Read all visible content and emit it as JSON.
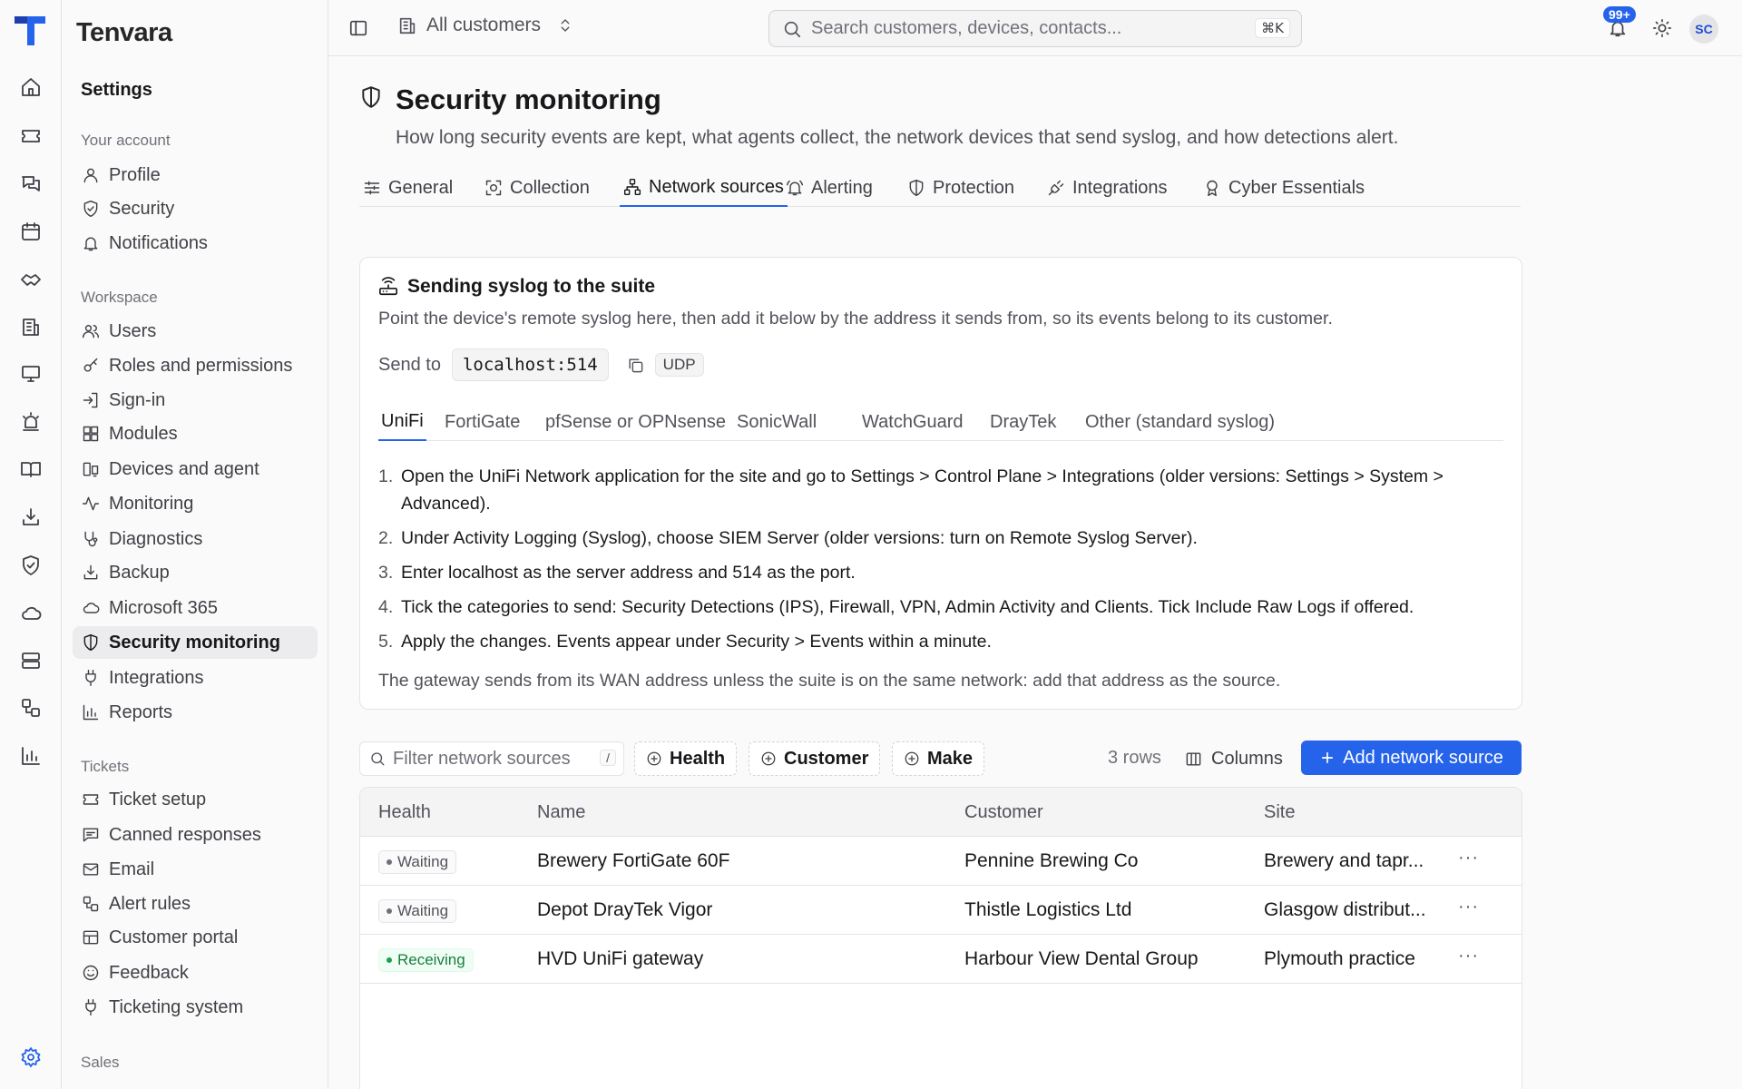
{
  "app": {
    "brand": "Tenvara"
  },
  "sidebar": {
    "title": "Settings",
    "groups": [
      {
        "label": "Your account",
        "items": [
          "Profile",
          "Security",
          "Notifications"
        ]
      },
      {
        "label": "Workspace",
        "items": [
          "Users",
          "Roles and permissions",
          "Sign-in",
          "Modules",
          "Devices and agent",
          "Monitoring",
          "Diagnostics",
          "Backup",
          "Microsoft 365",
          "Security monitoring",
          "Integrations",
          "Reports"
        ]
      },
      {
        "label": "Tickets",
        "items": [
          "Ticket setup",
          "Canned responses",
          "Email",
          "Alert rules",
          "Customer portal",
          "Feedback",
          "Ticketing system"
        ]
      },
      {
        "label": "Sales",
        "items": []
      }
    ],
    "active": "Security monitoring"
  },
  "topbar": {
    "customer_scope": "All customers",
    "search_placeholder": "Search customers, devices, contacts...",
    "search_shortcut": "⌘K",
    "notifications_badge": "99+",
    "avatar_initials": "SC"
  },
  "page": {
    "title": "Security monitoring",
    "subtitle": "How long security events are kept, what agents collect, the network devices that send syslog, and how detections alert.",
    "tabs": [
      "General",
      "Collection",
      "Network sources",
      "Alerting",
      "Protection",
      "Integrations",
      "Cyber Essentials"
    ],
    "active_tab": "Network sources"
  },
  "syslog_card": {
    "title": "Sending syslog to the suite",
    "description": "Point the device's remote syslog here, then add it below by the address it sends from, so its events belong to its customer.",
    "send_to_label": "Send to",
    "address": "localhost:514",
    "protocol": "UDP",
    "vendor_tabs": [
      "UniFi",
      "FortiGate",
      "pfSense or OPNsense",
      "SonicWall",
      "WatchGuard",
      "DrayTek",
      "Other (standard syslog)"
    ],
    "active_vendor": "UniFi",
    "steps": [
      "Open the UniFi Network application for the site and go to Settings > Control Plane > Integrations (older versions: Settings > System > Advanced).",
      "Under Activity Logging (Syslog), choose SIEM Server (older versions: turn on Remote Syslog Server).",
      "Enter localhost as the server address and 514 as the port.",
      "Tick the categories to send: Security Detections (IPS), Firewall, VPN, Admin Activity and Clients. Tick Include Raw Logs if offered.",
      "Apply the changes. Events appear under Security > Events within a minute."
    ],
    "footnote": "The gateway sends from its WAN address unless the suite is on the same network: add that address as the source."
  },
  "toolbar": {
    "filter_placeholder": "Filter network sources",
    "filter_shortcut": "/",
    "chips": [
      "Health",
      "Customer",
      "Make"
    ],
    "row_count": "3 rows",
    "columns_label": "Columns",
    "add_label": "Add network source"
  },
  "table": {
    "columns": [
      "Health",
      "Name",
      "Customer",
      "Site"
    ],
    "rows": [
      {
        "health": "Waiting",
        "name": "Brewery FortiGate 60F",
        "customer": "Pennine Brewing Co",
        "site": "Brewery and tapr..."
      },
      {
        "health": "Waiting",
        "name": "Depot DrayTek Vigor",
        "customer": "Thistle Logistics Ltd",
        "site": "Glasgow distribut..."
      },
      {
        "health": "Receiving",
        "name": "HVD UniFi gateway",
        "customer": "Harbour View Dental Group",
        "site": "Plymouth practice"
      }
    ],
    "row_menu": "···"
  },
  "colors": {
    "accent": "#2563eb",
    "healthy": "#16a34a"
  }
}
